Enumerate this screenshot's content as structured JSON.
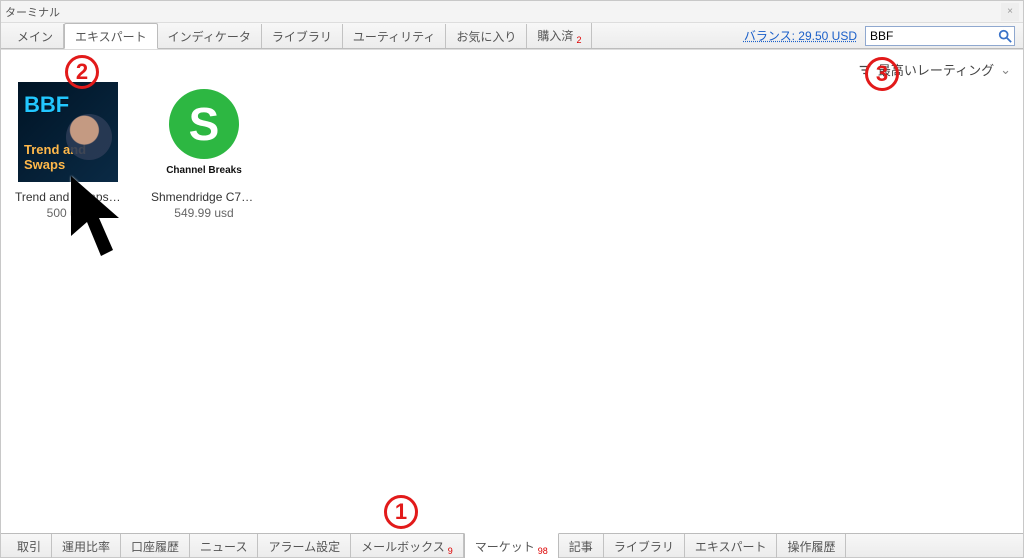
{
  "title": "ターミナル",
  "balance_label": "バランス: 29.50 USD",
  "search": {
    "value": "BBF",
    "placeholder": ""
  },
  "sort_label": "最高いレーティング",
  "top_tabs": [
    {
      "key": "main",
      "label": "メイン"
    },
    {
      "key": "expert",
      "label": "エキスパート",
      "active": true
    },
    {
      "key": "indicator",
      "label": "インディケータ"
    },
    {
      "key": "library",
      "label": "ライブラリ"
    },
    {
      "key": "utility",
      "label": "ユーティリティ"
    },
    {
      "key": "favorite",
      "label": "お気に入り"
    },
    {
      "key": "purchased",
      "label": "購入済",
      "badge": "2"
    }
  ],
  "bottom_tabs": [
    {
      "key": "trade",
      "label": "取引"
    },
    {
      "key": "usage",
      "label": "運用比率"
    },
    {
      "key": "acct",
      "label": "口座履歴"
    },
    {
      "key": "news",
      "label": "ニュース"
    },
    {
      "key": "alarm",
      "label": "アラーム設定"
    },
    {
      "key": "mailbox",
      "label": "メールボックス",
      "badge": "9"
    },
    {
      "key": "market",
      "label": "マーケット",
      "badge": "98",
      "active": true
    },
    {
      "key": "article",
      "label": "記事"
    },
    {
      "key": "library",
      "label": "ライブラリ"
    },
    {
      "key": "expert",
      "label": "エキスパート"
    },
    {
      "key": "ophist",
      "label": "操作履歴"
    }
  ],
  "items": [
    {
      "name": "Trend and Swaps B...",
      "price": "500 usd",
      "thumb": {
        "line1": "BBF",
        "line2": "Trend and Swaps"
      }
    },
    {
      "name": "Shmendridge C7M...",
      "price": "549.99 usd",
      "thumb": {
        "letter": "S",
        "caption": "Channel Breaks"
      }
    }
  ],
  "annotations": {
    "1": "1",
    "2": "2",
    "3": "3"
  }
}
